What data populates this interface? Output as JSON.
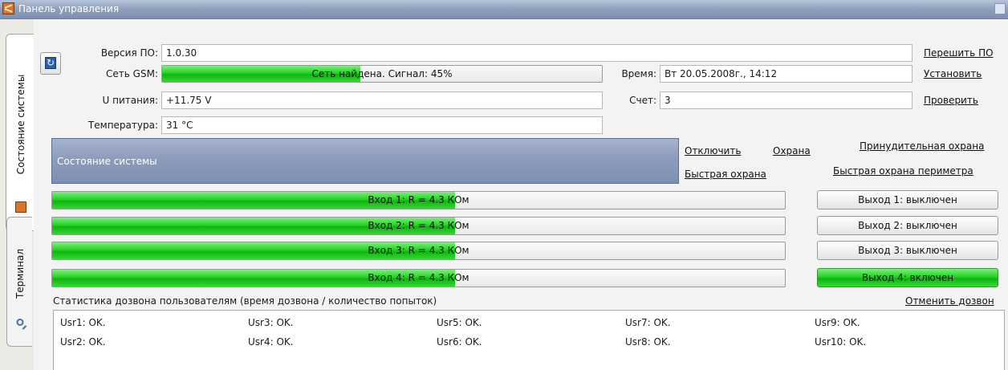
{
  "window": {
    "title": "Панель управления"
  },
  "tabs": [
    {
      "label": "Состояние системы",
      "icon": "system-state-icon",
      "active": true
    },
    {
      "label": "Терминал",
      "icon": "magnifier-icon",
      "active": false
    }
  ],
  "info": {
    "firmware_label": "Версия ПО:",
    "firmware_value": "1.0.30",
    "gsm_label": "Сеть GSM:",
    "gsm_status": "Сеть найдена. Сигнал: 45%",
    "gsm_signal_percent": 45,
    "voltage_label": "U питания:",
    "voltage_value": "+11.75 V",
    "temp_label": "Температура:",
    "temp_value": "31 °C",
    "time_label": "Время:",
    "time_value": "Вт 20.05.2008г., 14:12",
    "account_label": "Счет:",
    "account_value": "3"
  },
  "actions": {
    "reflash": "Перешить ПО",
    "set_time": "Установить",
    "check_account": "Проверить"
  },
  "system_state": {
    "title": "Состояние системы",
    "disarm": "Отключить",
    "arm": "Охрана",
    "forced_arm": "Принудительная охрана",
    "quick_arm": "Быстрая охрана",
    "quick_perimeter_arm": "Быстрая охрана периметра"
  },
  "inputs": [
    {
      "label": "Вход 1:  R = 4.3 КОм",
      "level_percent": 55
    },
    {
      "label": "Вход 2:  R = 4.3 КОм",
      "level_percent": 55
    },
    {
      "label": "Вход 3:  R = 4.3 КОм",
      "level_percent": 55
    },
    {
      "label": "Вход 4:  R = 4.3 КОм",
      "level_percent": 55
    }
  ],
  "outputs": [
    {
      "label": "Выход 1: выключен",
      "on": false
    },
    {
      "label": "Выход 2: выключен",
      "on": false
    },
    {
      "label": "Выход 3: выключен",
      "on": false
    },
    {
      "label": "Выход 4: включен",
      "on": true
    }
  ],
  "stats": {
    "label": "Статистика дозвона пользователям (время дозвона / количество попыток)",
    "cancel": "Отменить дозвон",
    "users": [
      "Usr1: OK.",
      "Usr2: OK.",
      "Usr3: OK.",
      "Usr4: OK.",
      "Usr5: OK.",
      "Usr6: OK.",
      "Usr7: OK.",
      "Usr8: OK.",
      "Usr9: OK.",
      "Usr10: OK."
    ]
  }
}
